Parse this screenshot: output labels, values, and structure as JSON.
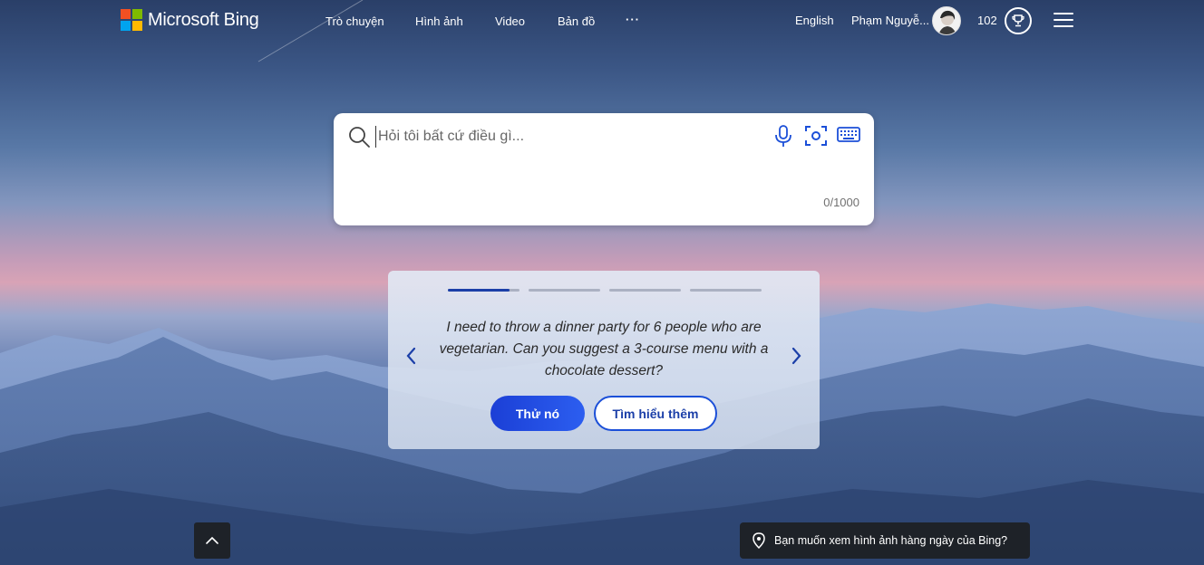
{
  "brand": {
    "name": "Microsoft Bing",
    "logo_colors": [
      "#f25022",
      "#7fba00",
      "#00a4ef",
      "#ffb900"
    ]
  },
  "nav": {
    "items": [
      {
        "label": "Trò chuyện"
      },
      {
        "label": "Hình ảnh"
      },
      {
        "label": "Video"
      },
      {
        "label": "Bản đồ"
      },
      {
        "label": "···"
      }
    ]
  },
  "header": {
    "language": "English",
    "user_name": "Phạm Nguyễ...",
    "points": "102"
  },
  "search": {
    "placeholder": "Hỏi tôi bất cứ điều gì...",
    "counter": "0/1000"
  },
  "carousel": {
    "prompt": "I need to throw a dinner party for 6 people who are vegetarian. Can you suggest a 3-course menu with a chocolate dessert?",
    "try_label": "Thử nó",
    "learn_label": "Tìm hiểu thêm",
    "slides": 4,
    "active_slide": 1
  },
  "footer": {
    "daily_image_prompt": "Bạn muốn xem hình ảnh hàng ngày của Bing?"
  },
  "colors": {
    "accent": "#1b3fd6",
    "card_bg": "#dfe6f2",
    "toast_bg": "#1e2228"
  },
  "icons": [
    "search-icon",
    "microphone-icon",
    "visual-search-icon",
    "keyboard-icon",
    "rewards-trophy-icon",
    "hamburger-menu-icon",
    "chevron-left-icon",
    "chevron-right-icon",
    "chevron-up-icon",
    "location-pin-icon"
  ]
}
